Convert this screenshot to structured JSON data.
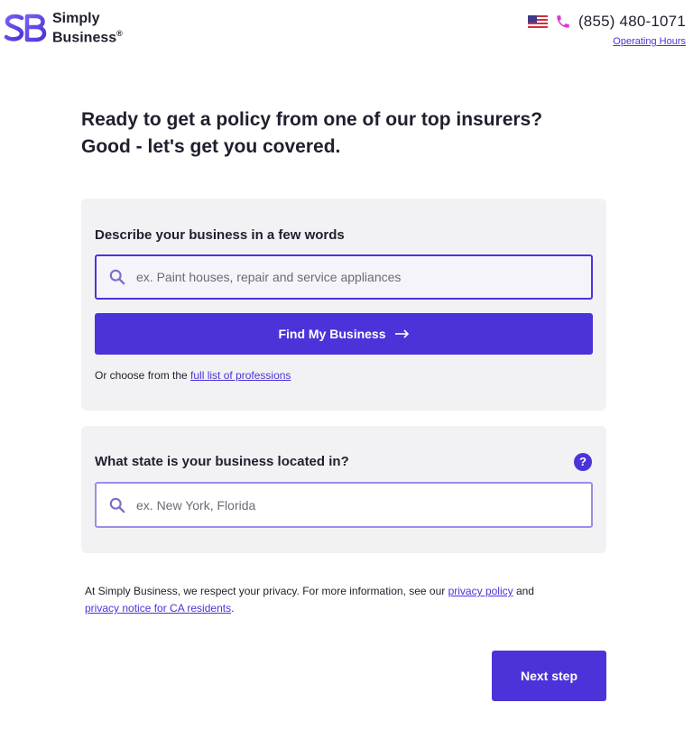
{
  "brand": {
    "logo_line1": "Simply",
    "logo_line2": "Business",
    "registered_mark": "®",
    "accent_color": "#4a34d9"
  },
  "header": {
    "flag_icon": "us-flag-icon",
    "phone_icon": "phone-icon",
    "phone_number": "(855) 480-1071",
    "hours_link": "Operating Hours"
  },
  "headline": {
    "line1": "Ready to get a policy from one of our top insurers?",
    "line2": "Good - let's get you covered."
  },
  "business_panel": {
    "label": "Describe your business in a few words",
    "search_icon": "search-icon",
    "placeholder": "ex. Paint houses, repair and service appliances",
    "button_label": "Find My Business",
    "button_icon": "arrow-right-icon",
    "choose_prefix": "Or choose from the ",
    "choose_link": "full list of professions"
  },
  "state_panel": {
    "label": "What state is your business located in?",
    "help_icon_glyph": "?",
    "search_icon": "search-icon",
    "placeholder": "ex. New York, Florida"
  },
  "privacy": {
    "text_prefix": "At Simply Business, we respect your privacy. For more information, see our ",
    "link1": "privacy policy",
    "text_middle": " and ",
    "link2": "privacy notice for CA residents",
    "text_suffix": "."
  },
  "next_button": {
    "label": "Next step"
  }
}
